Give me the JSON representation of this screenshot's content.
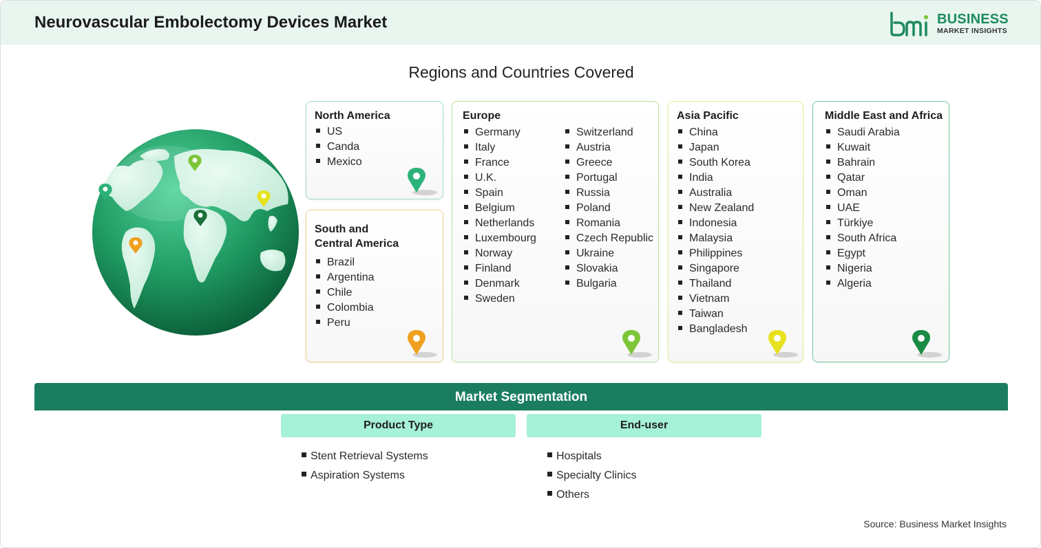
{
  "header": {
    "title": "Neurovascular Embolectomy Devices Market"
  },
  "logo": {
    "line1": "BUSINESS",
    "line2": "MARKET INSIGHTS",
    "color": "#1f8a5e"
  },
  "section_title": "Regions and Countries Covered",
  "regions": {
    "north_america": {
      "title": "North America",
      "items": [
        "US",
        "Canda",
        "Mexico"
      ],
      "color": "#2db37a",
      "border": "#9fe0bd"
    },
    "south_central_america": {
      "title_line1": "South and",
      "title_line2": "Central America",
      "items": [
        "Brazil",
        "Argentina",
        "Chile",
        "Colombia",
        "Peru"
      ],
      "color": "#f0a020",
      "border": "#f5cf8f"
    },
    "europe": {
      "title": "Europe",
      "col1": [
        "Germany",
        "Italy",
        "France",
        "U.K.",
        "Spain",
        "Belgium",
        "Netherlands",
        "Luxembourg",
        "Norway",
        "Finland",
        "Denmark",
        "Sweden"
      ],
      "col2": [
        "Switzerland",
        "Austria",
        "Greece",
        "Portugal",
        "Russia",
        "Poland",
        "Romania",
        "Czech Republic",
        "Ukraine",
        "Slovakia",
        "Bulgaria"
      ],
      "color": "#7dc63a",
      "border": "#bfe39a"
    },
    "asia_pacific": {
      "title": "Asia Pacific",
      "items": [
        "China",
        "Japan",
        "South Korea",
        "India",
        "Australia",
        "New Zealand",
        "Indonesia",
        "Malaysia",
        "Philippines",
        "Singapore",
        "Thailand",
        "Vietnam",
        "Taiwan",
        "Bangladesh"
      ],
      "color": "#e6e21e",
      "border": "#eeec8c"
    },
    "middle_east_africa": {
      "title": "Middle East and Africa",
      "items": [
        "Saudi Arabia",
        "Kuwait",
        "Bahrain",
        "Qatar",
        "Oman",
        "UAE",
        "Türkiye",
        "South Africa",
        "Egypt",
        "Nigeria",
        "Algeria"
      ],
      "color": "#1a8a45",
      "border": "#7cc79a"
    }
  },
  "segmentation": {
    "title": "Market Segmentation",
    "product_type": {
      "label": "Product Type",
      "items": [
        "Stent Retrieval Systems",
        "Aspiration Systems"
      ]
    },
    "end_user": {
      "label": "End-user",
      "items": [
        "Hospitals",
        "Specialty Clinics",
        "Others"
      ]
    }
  },
  "source": "Source: Business Market Insights",
  "icons": [
    "globe-icon",
    "location-pin-icon",
    "bmi-logo-icon"
  ]
}
